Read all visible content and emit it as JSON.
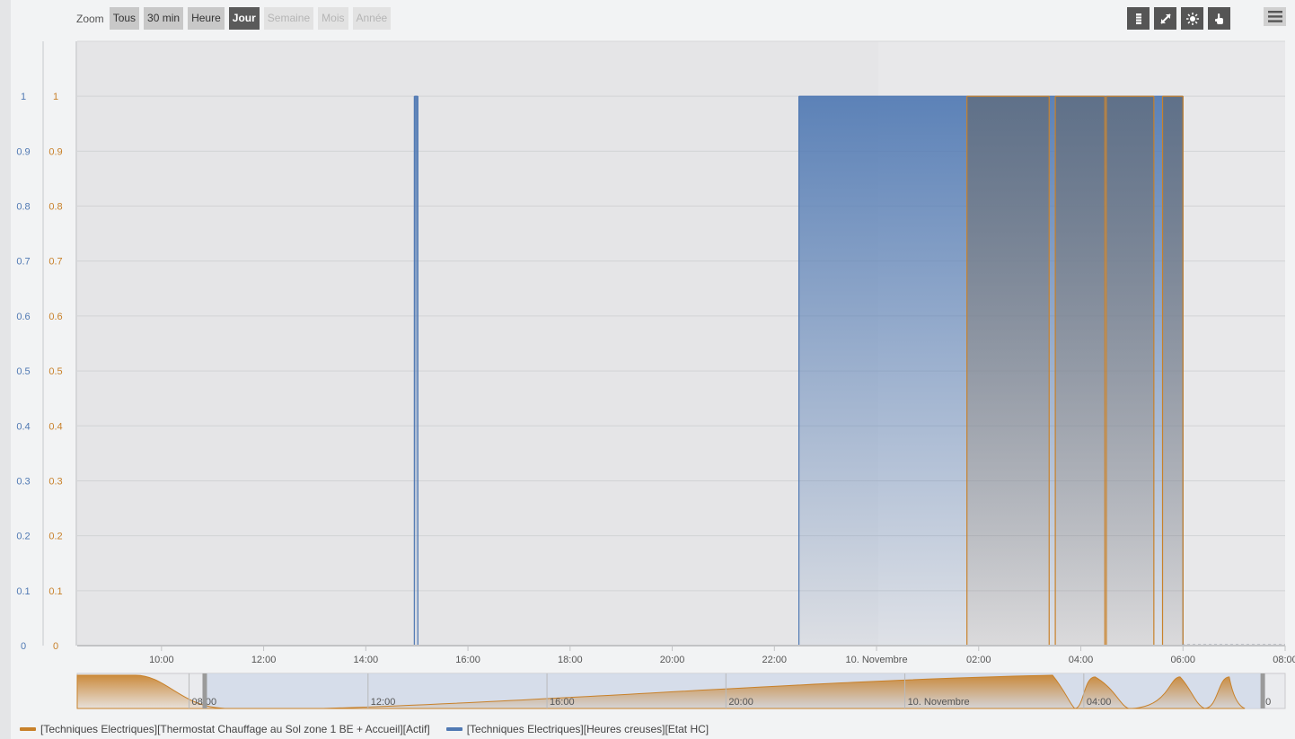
{
  "zoom": {
    "label": "Zoom",
    "buttons": [
      {
        "label": "Tous",
        "state": "normal"
      },
      {
        "label": "30 min",
        "state": "normal"
      },
      {
        "label": "Heure",
        "state": "normal"
      },
      {
        "label": "Jour",
        "state": "active"
      },
      {
        "label": "Semaine",
        "state": "disabled"
      },
      {
        "label": "Mois",
        "state": "disabled"
      },
      {
        "label": "Année",
        "state": "disabled"
      }
    ]
  },
  "toolbar": {
    "buttons": [
      {
        "icon": "bar-chart-icon"
      },
      {
        "icon": "compress-icon"
      },
      {
        "icon": "sun-icon"
      },
      {
        "icon": "pointer-hand-icon"
      }
    ],
    "menu_icon": "hamburger-menu-icon"
  },
  "colors": {
    "orange": "#c8812a",
    "blue": "#5079b3"
  },
  "chart_data": {
    "type": "area",
    "time_origin": "2020-11-09 08:00",
    "x_range_hours": [
      0.35,
      24
    ],
    "y_range": [
      0,
      1.1
    ],
    "yaxis_left_ticks": [
      "0",
      "0.1",
      "0.2",
      "0.3",
      "0.4",
      "0.5",
      "0.6",
      "0.7",
      "0.8",
      "0.9",
      "1"
    ],
    "yaxis_right_ticks": [
      "0",
      "0.1",
      "0.2",
      "0.3",
      "0.4",
      "0.5",
      "0.6",
      "0.7",
      "0.8",
      "0.9",
      "1"
    ],
    "x_ticks": [
      {
        "h": 2,
        "label": "10:00"
      },
      {
        "h": 4,
        "label": "12:00"
      },
      {
        "h": 6,
        "label": "14:00"
      },
      {
        "h": 8,
        "label": "16:00"
      },
      {
        "h": 10,
        "label": "18:00"
      },
      {
        "h": 12,
        "label": "20:00"
      },
      {
        "h": 14,
        "label": "22:00"
      },
      {
        "h": 16,
        "label": "10. Novembre"
      },
      {
        "h": 18,
        "label": "02:00"
      },
      {
        "h": 20,
        "label": "04:00"
      },
      {
        "h": 22,
        "label": "06:00"
      },
      {
        "h": 24,
        "label": "08:00"
      }
    ],
    "series": [
      {
        "name": "[Techniques Electriques][Heures creuses][Etat HC]",
        "color": "#5079b3",
        "on_intervals": [
          [
            6.95,
            7.02
          ],
          [
            14.48,
            22
          ]
        ]
      },
      {
        "name": "[Techniques Electriques][Thermostat Chauffage au Sol zone 1 BE + Accueil][Actif]",
        "color": "#c8812a",
        "on_intervals": [
          [
            17.77,
            19.38
          ],
          [
            19.5,
            20.47
          ],
          [
            20.5,
            21.43
          ],
          [
            21.6,
            22
          ]
        ]
      }
    ],
    "navigator": {
      "x_range_hours": [
        -2.5,
        24.5
      ],
      "selected_hours": [
        0.35,
        24
      ],
      "tick_labels": [
        {
          "h": -4,
          "label": "04:00"
        },
        {
          "h": 0,
          "label": "08:00"
        },
        {
          "h": 4,
          "label": "12:00"
        },
        {
          "h": 8,
          "label": "16:00"
        },
        {
          "h": 12,
          "label": "20:00"
        },
        {
          "h": 16,
          "label": "10. Novembre"
        },
        {
          "h": 20,
          "label": "04:00"
        },
        {
          "h": 24,
          "label": "0"
        }
      ]
    }
  },
  "legend": [
    {
      "label": "[Techniques Electriques][Thermostat Chauffage au Sol zone 1 BE + Accueil][Actif]",
      "color": "#c8812a"
    },
    {
      "label": "[Techniques Electriques][Heures creuses][Etat HC]",
      "color": "#5079b3"
    }
  ]
}
